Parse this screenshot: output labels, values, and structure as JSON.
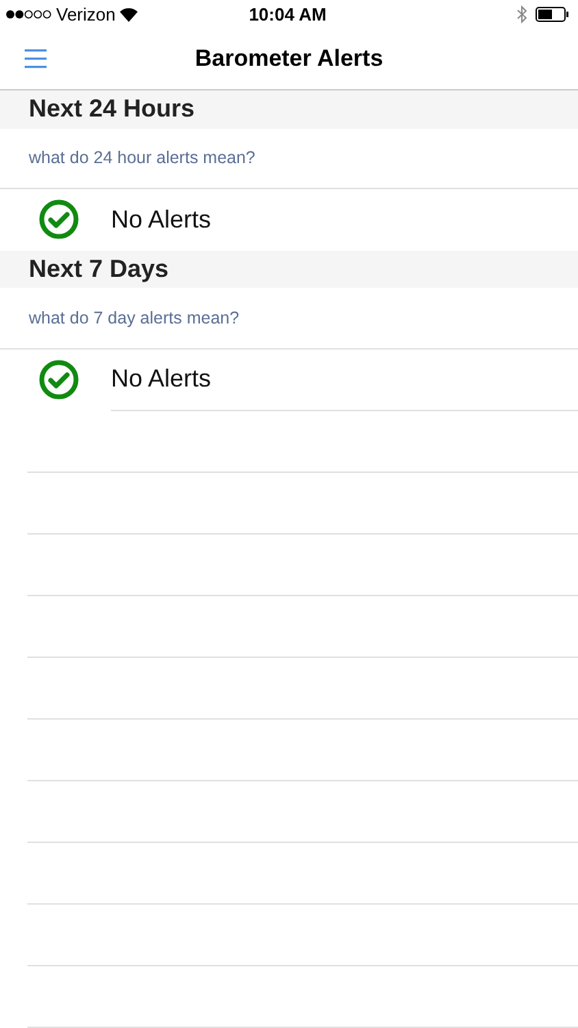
{
  "status_bar": {
    "carrier": "Verizon",
    "time": "10:04 AM"
  },
  "nav_bar": {
    "title": "Barometer Alerts"
  },
  "sections": [
    {
      "title": "Next 24 Hours",
      "help_link": "what do 24 hour alerts mean?",
      "alerts": [
        {
          "kind": "ok",
          "text": "No Alerts"
        }
      ]
    },
    {
      "title": "Next 7 Days",
      "help_link": "what do 7 day alerts mean?",
      "alerts": [
        {
          "kind": "ok",
          "text": "No Alerts"
        }
      ]
    }
  ]
}
